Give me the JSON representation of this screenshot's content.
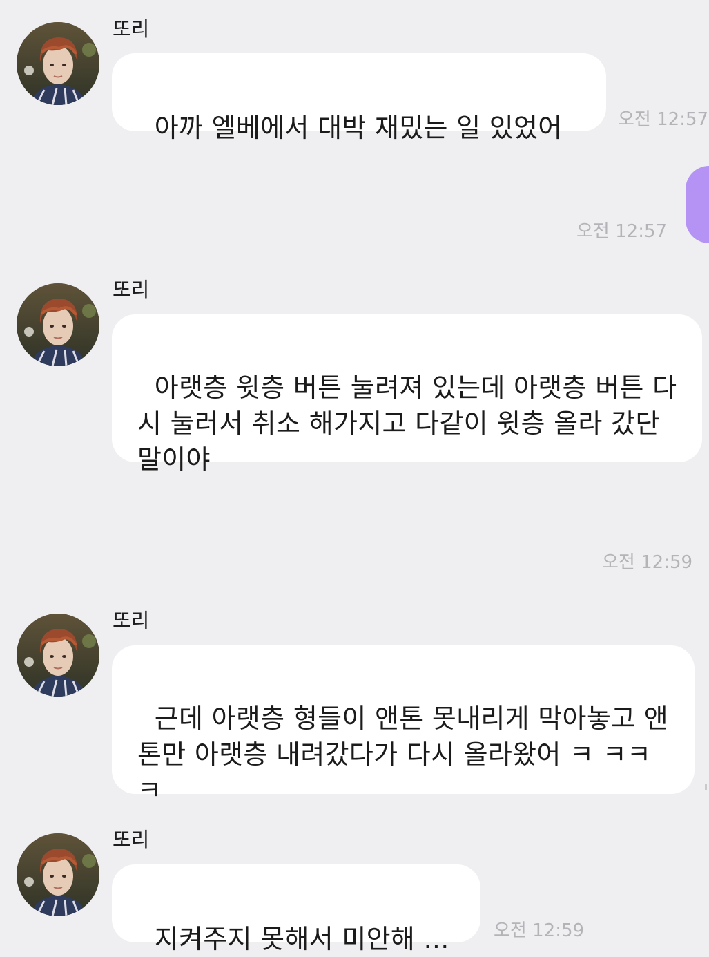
{
  "messages": [
    {
      "sender": "또리",
      "text": "아까 엘베에서 대박 재밌는 일 있었어",
      "time": "오전 12:57"
    },
    {
      "time": "오전 12:57"
    },
    {
      "sender": "또리",
      "text": "아랫층 윗층 버튼 눌려져 있는데 아랫층 버튼 다시 눌러서 취소 해가지고 다같이 윗층 올라 갔단 말이야"
    },
    {
      "time": "오전 12:59"
    },
    {
      "sender": "또리",
      "text": "근데 아랫층 형들이 앤톤 못내리게 막아놓고 앤톤만 아랫층 내려갔다가 다시 올라왔어 ㅋ ㅋㅋㅋ"
    },
    {
      "sender": "또리",
      "text": "지켜주지 못해서 미안해 ...",
      "time": "오전 12:59"
    }
  ],
  "colors": {
    "background": "#efeff1",
    "incoming_bubble": "#ffffff",
    "outgoing_bubble": "#b593f5",
    "timestamp": "#b4b4b8"
  },
  "icons": {
    "avatar": "profile-photo-avatar"
  }
}
